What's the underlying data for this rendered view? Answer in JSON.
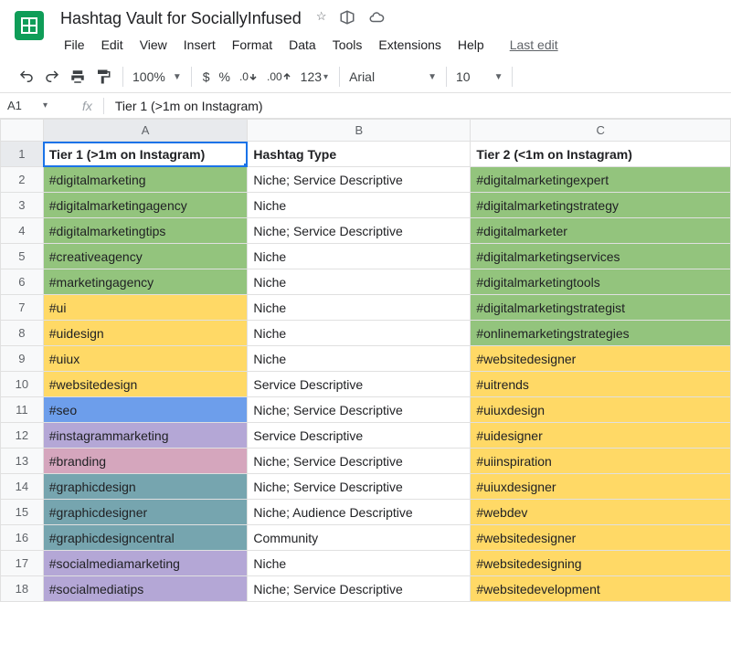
{
  "doc": {
    "title": "Hashtag Vault for SociallyInfused"
  },
  "menus": {
    "file": "File",
    "edit": "Edit",
    "view": "View",
    "insert": "Insert",
    "format": "Format",
    "data": "Data",
    "tools": "Tools",
    "extensions": "Extensions",
    "help": "Help",
    "lastedit": "Last edit"
  },
  "toolbar": {
    "zoom": "100%",
    "currency": "$",
    "percent": "%",
    "dec_dec": ".0",
    "dec_inc": ".00",
    "num": "123",
    "font": "Arial",
    "fontsize": "10"
  },
  "namebox": {
    "ref": "A1"
  },
  "formula": {
    "label": "fx",
    "value": "Tier 1 (>1m on Instagram)"
  },
  "columns": {
    "A": "A",
    "B": "B",
    "C": "C"
  },
  "rows": [
    {
      "n": "1",
      "a": "Tier 1 (>1m on Instagram)",
      "b": "Hashtag Type",
      "c": "Tier 2 (<1m on Instagram)",
      "ac": "",
      "cc": "",
      "hdr": true,
      "sel": true
    },
    {
      "n": "2",
      "a": "#digitalmarketing",
      "b": "Niche; Service Descriptive",
      "c": "#digitalmarketingexpert",
      "ac": "c-green",
      "cc": "c-green"
    },
    {
      "n": "3",
      "a": "#digitalmarketingagency",
      "b": "Niche",
      "c": "#digitalmarketingstrategy",
      "ac": "c-green",
      "cc": "c-green"
    },
    {
      "n": "4",
      "a": "#digitalmarketingtips",
      "b": "Niche; Service Descriptive",
      "c": "#digitalmarketer",
      "ac": "c-green",
      "cc": "c-green"
    },
    {
      "n": "5",
      "a": "#creativeagency",
      "b": "Niche",
      "c": "#digitalmarketingservices",
      "ac": "c-green",
      "cc": "c-green"
    },
    {
      "n": "6",
      "a": "#marketingagency",
      "b": "Niche",
      "c": "#digitalmarketingtools",
      "ac": "c-green",
      "cc": "c-green"
    },
    {
      "n": "7",
      "a": "#ui",
      "b": "Niche",
      "c": "#digitalmarketingstrategist",
      "ac": "c-yellow",
      "cc": "c-green"
    },
    {
      "n": "8",
      "a": "#uidesign",
      "b": "Niche",
      "c": "#onlinemarketingstrategies",
      "ac": "c-yellow",
      "cc": "c-green"
    },
    {
      "n": "9",
      "a": "#uiux",
      "b": "Niche",
      "c": "#websitedesigner",
      "ac": "c-yellow",
      "cc": "c-yellow"
    },
    {
      "n": "10",
      "a": "#websitedesign",
      "b": "Service Descriptive",
      "c": "#uitrends",
      "ac": "c-yellow",
      "cc": "c-yellow"
    },
    {
      "n": "11",
      "a": "#seo",
      "b": "Niche; Service Descriptive",
      "c": "#uiuxdesign",
      "ac": "c-blue",
      "cc": "c-yellow"
    },
    {
      "n": "12",
      "a": "#instagrammarketing",
      "b": "Service Descriptive",
      "c": "#uidesigner",
      "ac": "c-purple",
      "cc": "c-yellow"
    },
    {
      "n": "13",
      "a": "#branding",
      "b": "Niche; Service Descriptive",
      "c": "#uiinspiration",
      "ac": "c-pink",
      "cc": "c-yellow"
    },
    {
      "n": "14",
      "a": "#graphicdesign",
      "b": "Niche; Service Descriptive",
      "c": "#uiuxdesigner",
      "ac": "c-teal",
      "cc": "c-yellow"
    },
    {
      "n": "15",
      "a": "#graphicdesigner",
      "b": "Niche; Audience Descriptive",
      "c": "#webdev",
      "ac": "c-teal",
      "cc": "c-yellow"
    },
    {
      "n": "16",
      "a": "#graphicdesigncentral",
      "b": "Community",
      "c": "#websitedesigner",
      "ac": "c-teal",
      "cc": "c-yellow"
    },
    {
      "n": "17",
      "a": "#socialmediamarketing",
      "b": "Niche",
      "c": "#websitedesigning",
      "ac": "c-purple",
      "cc": "c-yellow"
    },
    {
      "n": "18",
      "a": "#socialmediatips",
      "b": "Niche; Service Descriptive",
      "c": "#websitedevelopment",
      "ac": "c-purple",
      "cc": "c-yellow"
    }
  ]
}
